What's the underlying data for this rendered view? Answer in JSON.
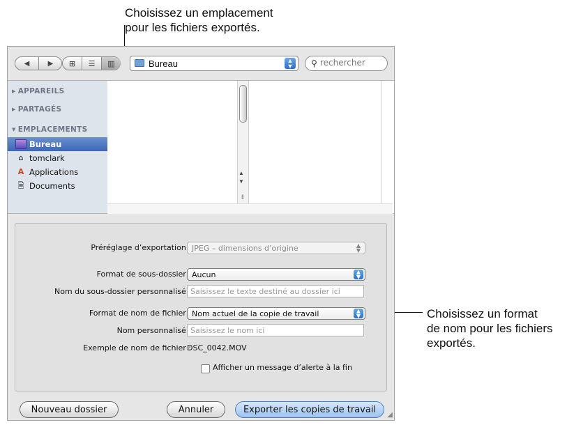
{
  "callouts": {
    "top": [
      "Choisissez un emplacement",
      "pour les fichiers exportés."
    ],
    "right": [
      "Choisissez un format",
      "de nom pour les fichiers",
      "exportés."
    ]
  },
  "toolbar": {
    "back_icon": "back-arrow-icon",
    "forward_icon": "forward-arrow-icon",
    "view_modes": [
      "icon-view-icon",
      "list-view-icon",
      "column-view-icon"
    ],
    "location": "Bureau",
    "search_placeholder": "rechercher"
  },
  "sidebar": {
    "sections": [
      {
        "label": "APPAREILS",
        "expanded": false
      },
      {
        "label": "PARTAGÉS",
        "expanded": false
      },
      {
        "label": "EMPLACEMENTS",
        "expanded": true
      }
    ],
    "items": [
      {
        "label": "Bureau",
        "icon": "desktop-icon",
        "selected": true
      },
      {
        "label": "tomclark",
        "icon": "home-icon",
        "selected": false
      },
      {
        "label": "Applications",
        "icon": "applications-icon",
        "selected": false
      },
      {
        "label": "Documents",
        "icon": "documents-icon",
        "selected": false
      }
    ]
  },
  "options": {
    "preset_label": "Préréglage d’exportation :",
    "preset_value": "JPEG – dimensions d’origine",
    "subfolder_format_label": "Format de sous-dossier :",
    "subfolder_format_value": "Aucun",
    "custom_subfolder_label": "Nom du sous-dossier personnalisé :",
    "custom_subfolder_placeholder": "Saisissez le texte destiné au dossier ici",
    "filename_format_label": "Format de nom de fichier :",
    "filename_format_value": "Nom actuel de la copie de travail",
    "custom_name_label": "Nom personnalisé :",
    "custom_name_placeholder": "Saisissez le nom ici",
    "example_label": "Exemple de nom de fichier :",
    "example_value": "DSC_0042.MOV",
    "alert_checkbox_label": "Afficher un message d’alerte à la fin",
    "alert_checked": false
  },
  "buttons": {
    "new_folder": "Nouveau dossier",
    "cancel": "Annuler",
    "export": "Exporter les copies de travail"
  },
  "colors": {
    "selection": "#3c66b6",
    "sidebar_bg": "#dde4ec",
    "default_button": "#9cc3ef"
  }
}
